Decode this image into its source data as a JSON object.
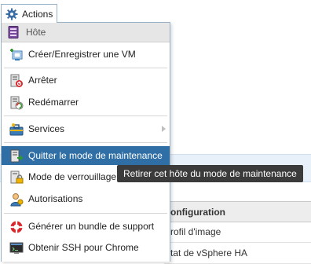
{
  "actions_button": {
    "label": "Actions",
    "icon": "gear-icon"
  },
  "menu": {
    "header": {
      "label": "Hôte",
      "icon": "host-icon"
    },
    "items": [
      {
        "label": "Créer/Enregistrer une VM",
        "icon": "create-vm-icon"
      },
      {
        "label": "Arrêter",
        "icon": "shutdown-icon"
      },
      {
        "label": "Redémarrer",
        "icon": "restart-icon"
      },
      {
        "label": "Services",
        "icon": "services-icon",
        "has_submenu": true
      },
      {
        "label": "Quitter le mode de maintenance",
        "icon": "exit-maintenance-icon",
        "selected": true
      },
      {
        "label": "Mode de verrouillage",
        "icon": "lockdown-icon"
      },
      {
        "label": "Autorisations",
        "icon": "permissions-icon"
      },
      {
        "label": "Générer un bundle de support",
        "icon": "support-bundle-icon"
      },
      {
        "label": "Obtenir SSH pour Chrome",
        "icon": "ssh-icon"
      }
    ]
  },
  "tooltip": {
    "text": "Retirer cet hôte du mode de maintenance"
  },
  "background_table": {
    "header": "onfiguration",
    "rows": [
      "rofil d'image",
      "tat de vSphere HA"
    ]
  },
  "colors": {
    "selected_bg": "#2f6fa5",
    "tooltip_bg": "#3b3b3b",
    "menu_border": "#9ab2c8"
  }
}
